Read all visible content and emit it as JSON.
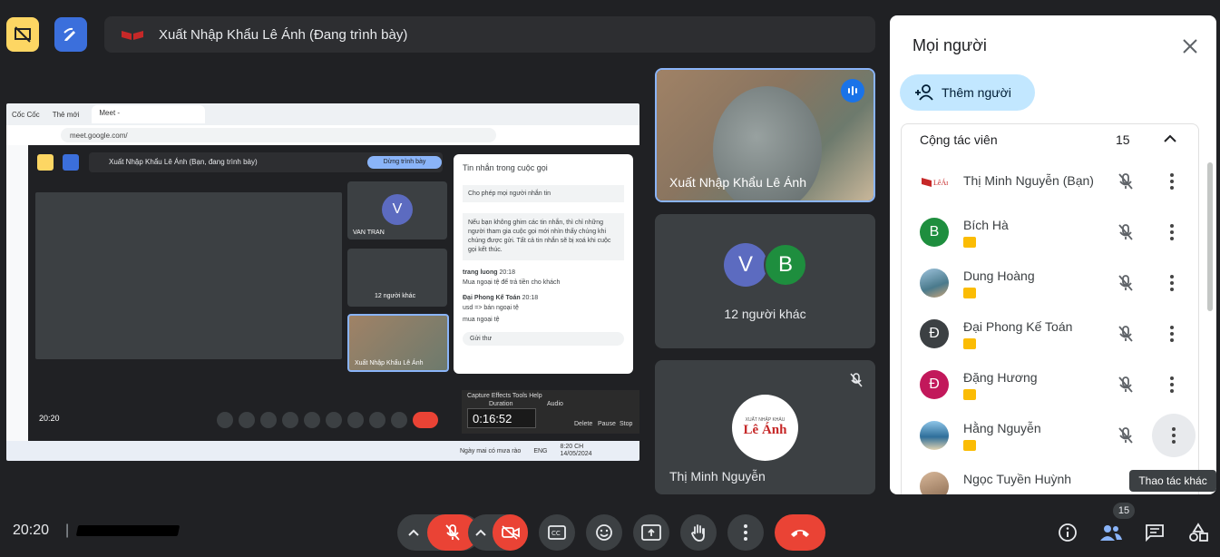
{
  "meeting": {
    "presenter_title": "Xuất Nhập Khẩu Lê Ánh (Đang trình bày)",
    "clock": "20:20"
  },
  "shared_screen": {
    "browser_name": "Cốc Cốc",
    "new_tab": "Thẻ mới",
    "meet_tab": "Meet -",
    "url": "meet.google.com/",
    "inner_title": "Xuất Nhập Khẩu Lê Ánh (Bạn, đang trình bày)",
    "stop_btn": "Dừng trình bày",
    "chat_title": "Tin nhắn trong cuộc gọi",
    "chat_allow": "Cho phép mọi người nhắn tin",
    "chat_notice": "Nếu bạn không ghim các tin nhắn, thì chỉ những người tham gia cuộc gọi mới nhìn thấy chúng khi chúng được gửi. Tất cả tin nhắn sẽ bị xoá khi cuộc gọi kết thúc.",
    "msg1_name": "trang luong",
    "msg1_time": "20:18",
    "msg1_text": "Mua ngoại tệ để trả tiền cho khách",
    "msg2_name": "Đại Phong Kế Toán",
    "msg2_time": "20:18",
    "msg2_text": "usd => bán ngoại tệ",
    "msg3_text": "mua ngoại tệ",
    "send_placeholder": "Gửi thư",
    "tile1_name": "VAN TRAN",
    "tile2_name": "12 người khác",
    "tile3_name": "Xuất Nhập Khẩu Lê Ánh",
    "inner_clock": "20:20",
    "rec_menu": "Capture   Effects   Tools   Help",
    "rec_duration_label": "Duration",
    "rec_audio_label": "Audio",
    "rec_time": "0:16:52",
    "rec_delete": "Delete",
    "rec_pause": "Pause",
    "rec_stop": "Stop",
    "weather": "Ngày mai có mưa rào",
    "lang": "ENG",
    "task_time": "8:20 CH",
    "task_date": "14/05/2024"
  },
  "tiles": {
    "speaker_name": "Xuất Nhập Khẩu Lê Ánh",
    "others_label": "12 người khác",
    "others_initials": [
      "V",
      "B"
    ],
    "self_name": "Thị Minh Nguyễn",
    "self_logo_small": "XUẤT NHẬP KHẨU",
    "self_logo": "Lê Ánh"
  },
  "panel": {
    "title": "Mọi người",
    "add_label": "Thêm người",
    "section_title": "Cộng tác viên",
    "section_count": "15",
    "people": [
      {
        "name": "Thị Minh Nguyễn (Bạn)",
        "avatar": "logo",
        "color": "#ffffff",
        "role": false
      },
      {
        "name": "Bích Hà",
        "avatar": "B",
        "color": "#1e8e3e",
        "role": true
      },
      {
        "name": "Dung Hoàng",
        "avatar": "photo",
        "color": "#7aa6c2",
        "role": true
      },
      {
        "name": "Đại Phong Kế Toán",
        "avatar": "Đ",
        "color": "#3c4043",
        "role": true
      },
      {
        "name": "Đặng Hương",
        "avatar": "Đ",
        "color": "#c2185b",
        "role": true
      },
      {
        "name": "Hằng Nguyễn",
        "avatar": "photo",
        "color": "#4f8fb3",
        "role": true
      },
      {
        "name": "Ngọc Tuyền Huỳnh",
        "avatar": "photo",
        "color": "#b08a6a",
        "role": false
      }
    ],
    "tooltip": "Thao tác khác",
    "people_count_badge": "15"
  },
  "colors": {
    "accent_blue": "#1a73e8",
    "present_yellow": "#fdd663",
    "end_red": "#ea4335",
    "panel_bg": "#ffffff",
    "stage_bg": "#202124"
  }
}
